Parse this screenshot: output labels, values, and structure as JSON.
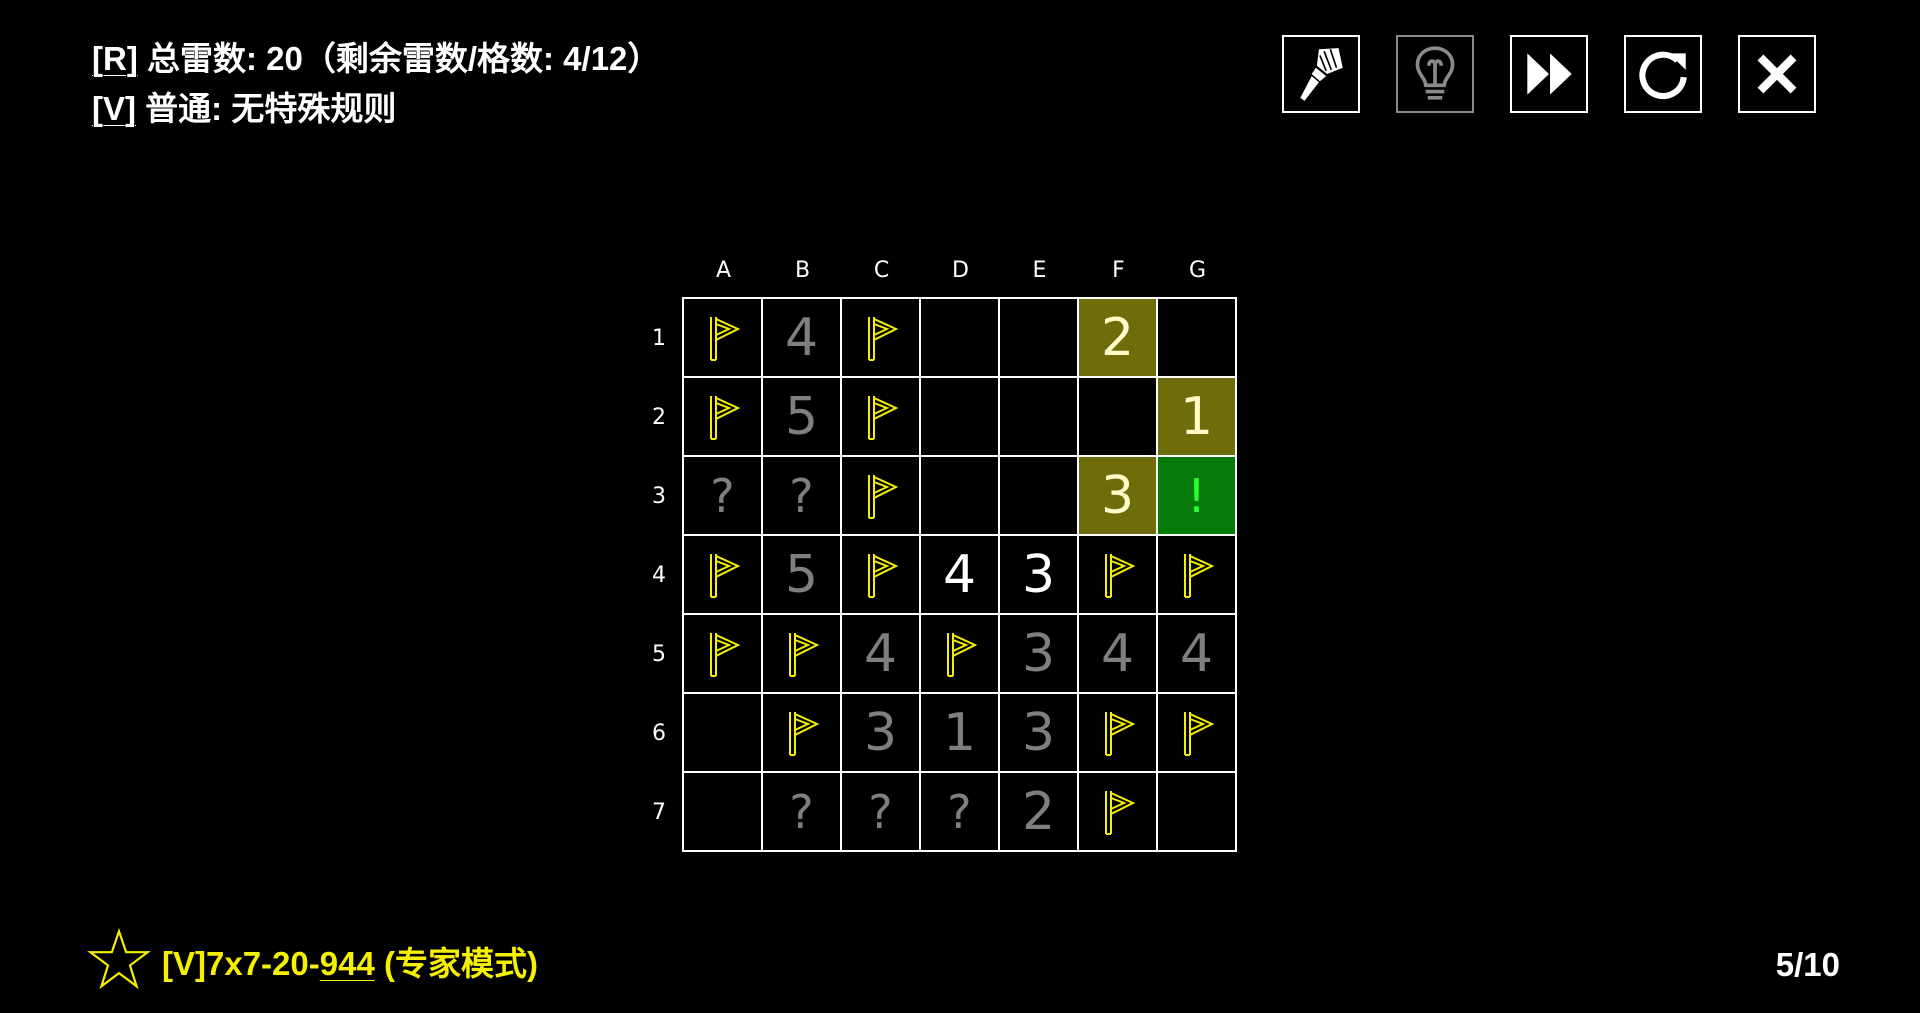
{
  "rules": {
    "line1_key": "[R]",
    "line1_text": " 总雷数:  20（剩余雷数/格数: 4/12）",
    "line2_key": "[V]",
    "line2_text": " 普通: 无特殊规则"
  },
  "toolbar": [
    {
      "icon": "brush-icon",
      "state": "enabled"
    },
    {
      "icon": "lightbulb-icon",
      "state": "dimmed"
    },
    {
      "icon": "fast-forward-icon",
      "state": "enabled"
    },
    {
      "icon": "restart-icon",
      "state": "enabled"
    },
    {
      "icon": "close-icon",
      "state": "enabled"
    }
  ],
  "board": {
    "columns": [
      "A",
      "B",
      "C",
      "D",
      "E",
      "F",
      "G"
    ],
    "rows": [
      "1",
      "2",
      "3",
      "4",
      "5",
      "6",
      "7"
    ],
    "cells": [
      [
        "F",
        "4",
        "F",
        "",
        "",
        "2h",
        ""
      ],
      [
        "F",
        "5",
        "F",
        "",
        "",
        "",
        "1h"
      ],
      [
        "?",
        "?",
        "F",
        "",
        "",
        "3h",
        "!"
      ],
      [
        "F",
        "5",
        "F",
        "4w",
        "3w",
        "F",
        "F"
      ],
      [
        "F",
        "F",
        "4",
        "F",
        "3",
        "4",
        "4"
      ],
      [
        "",
        "F",
        "3",
        "1",
        "3",
        "F",
        "F"
      ],
      [
        "",
        "?",
        "?",
        "?",
        "2",
        "F",
        ""
      ]
    ],
    "colors": {
      "flag": "#f5f000",
      "highlight": "#6f6c0c",
      "safe": "#047a08",
      "dim_number": "#7f7f7f"
    }
  },
  "footer": {
    "puzzle_prefix": "[V]7x7-20-",
    "puzzle_seed": "944",
    "puzzle_suffix": " (专家模式)",
    "progress": "5/10"
  }
}
